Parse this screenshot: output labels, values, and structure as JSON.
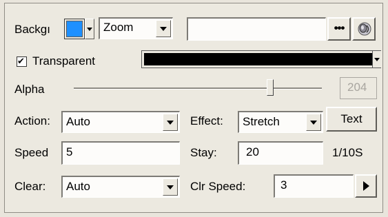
{
  "colors": {
    "swatch": "#1e90ff",
    "color_bar": "#000000"
  },
  "background": {
    "label": "Backgı",
    "mode_value": "Zoom",
    "path_value": "",
    "browse_label": "•••",
    "preview_icon": "speaker-icon"
  },
  "transparent": {
    "label": "Transparent",
    "checked": true,
    "checkmark": "✔"
  },
  "alpha": {
    "label": "Alpha",
    "value": "204",
    "slider_fraction": 0.8
  },
  "action": {
    "label": "Action:",
    "value": "Auto"
  },
  "effect": {
    "label": "Effect:",
    "value": "Stretch"
  },
  "text_button": {
    "label": "Text"
  },
  "speed": {
    "label": "Speed",
    "value": "5"
  },
  "stay": {
    "label": "Stay:",
    "value": "20",
    "unit": "1/10S"
  },
  "clear": {
    "label": "Clear:",
    "value": "Auto"
  },
  "clr_speed": {
    "label": "Clr Speed:",
    "value": "3"
  },
  "play_icon": "play-arrow-icon"
}
